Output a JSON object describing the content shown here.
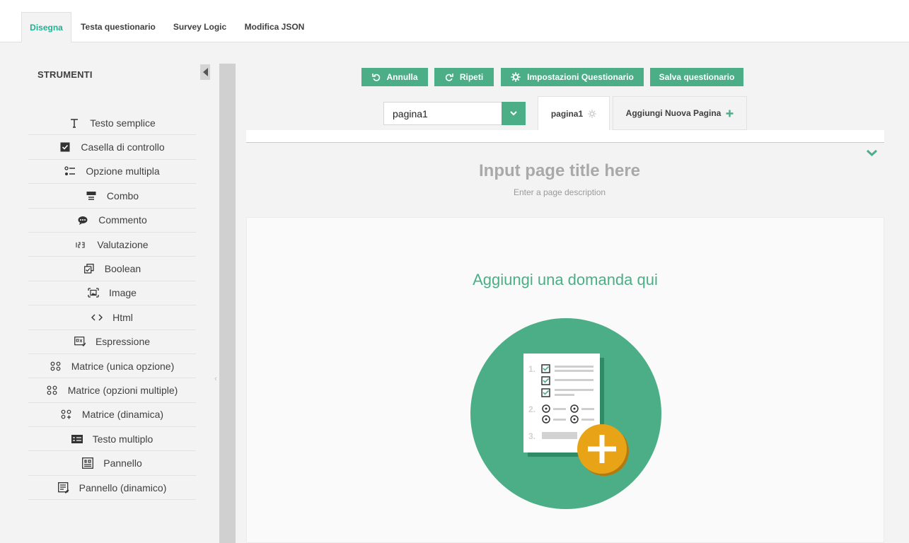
{
  "top_tabs": [
    {
      "label": "Disegna",
      "active": true
    },
    {
      "label": "Testa questionario",
      "active": false
    },
    {
      "label": "Survey Logic",
      "active": false
    },
    {
      "label": "Modifica JSON",
      "active": false
    }
  ],
  "sidebar": {
    "title": "STRUMENTI",
    "tools": [
      {
        "label": "Testo semplice",
        "icon": "text-icon"
      },
      {
        "label": "Casella di controllo",
        "icon": "checkbox-icon"
      },
      {
        "label": "Opzione multipla",
        "icon": "radiogroup-icon"
      },
      {
        "label": "Combo",
        "icon": "dropdown-icon"
      },
      {
        "label": "Commento",
        "icon": "comment-icon"
      },
      {
        "label": "Valutazione",
        "icon": "rating-icon"
      },
      {
        "label": "Boolean",
        "icon": "boolean-icon"
      },
      {
        "label": "Image",
        "icon": "image-icon"
      },
      {
        "label": "Html",
        "icon": "html-icon"
      },
      {
        "label": "Espressione",
        "icon": "expression-icon"
      },
      {
        "label": "Matrice (unica opzione)",
        "icon": "matrix-icon"
      },
      {
        "label": "Matrice (opzioni multiple)",
        "icon": "matrix-dropdown-icon"
      },
      {
        "label": "Matrice (dinamica)",
        "icon": "matrix-dynamic-icon"
      },
      {
        "label": "Testo multiplo",
        "icon": "multipletext-icon"
      },
      {
        "label": "Pannello",
        "icon": "panel-icon"
      },
      {
        "label": "Pannello (dinamico)",
        "icon": "paneldynamic-icon"
      }
    ]
  },
  "toolbar": {
    "undo_label": "Annulla",
    "redo_label": "Ripeti",
    "settings_label": "Impostazioni Questionario",
    "save_label": "Salva questionario"
  },
  "page_selector": {
    "selected": "pagina1"
  },
  "page_tabs": {
    "current": "pagina1",
    "add_label": "Aggiungi Nuova Pagina"
  },
  "page": {
    "title_placeholder": "Input page title here",
    "description_placeholder": "Enter a page description",
    "drop_hint": "Aggiungi una domanda qui"
  },
  "illustration_numbers": [
    "1.",
    "2.",
    "3."
  ],
  "colors": {
    "accent": "#4cae87",
    "plus_badge": "#e8a317"
  }
}
